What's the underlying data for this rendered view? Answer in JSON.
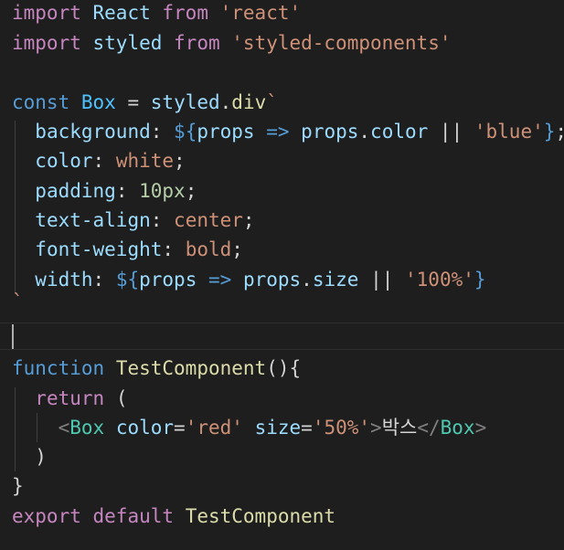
{
  "editor": {
    "lines": {
      "l1": {
        "kw_import": "import",
        "ident": "React",
        "kw_from": "from",
        "str": "'react'"
      },
      "l2": {
        "kw_import": "import",
        "ident": "styled",
        "kw_from": "from",
        "str": "'styled-components'"
      },
      "l4": {
        "kw_const": "const",
        "ident": "Box",
        "eq": "=",
        "styled": "styled",
        "dot": ".",
        "div": "div",
        "tick": "`"
      },
      "l5": {
        "prop": "background",
        "colon": ":",
        "tmpl_open": "${",
        "arg": "props",
        "arrow": "=>",
        "obj": "props",
        "dot": ".",
        "field": "color",
        "or": "||",
        "str": "'blue'",
        "tmpl_close": "}",
        "semi": ";"
      },
      "l6": {
        "prop": "color",
        "colon": ":",
        "value": "white",
        "semi": ";"
      },
      "l7": {
        "prop": "padding",
        "colon": ":",
        "value": "10px",
        "semi": ";"
      },
      "l8": {
        "prop": "text-align",
        "colon": ":",
        "value": "center",
        "semi": ";"
      },
      "l9": {
        "prop": "font-weight",
        "colon": ":",
        "value": "bold",
        "semi": ";"
      },
      "l10": {
        "prop": "width",
        "colon": ":",
        "tmpl_open": "${",
        "arg": "props",
        "arrow": "=>",
        "obj": "props",
        "dot": ".",
        "field": "size",
        "or": "||",
        "str": "'100%'",
        "tmpl_close": "}"
      },
      "l11": {
        "tick": "`"
      },
      "l13": {
        "kw_function": "function",
        "name": "TestComponent",
        "parens": "(){"
      },
      "l14": {
        "kw_return": "return",
        "paren": "("
      },
      "l15": {
        "lt": "<",
        "comp": "Box",
        "attr1": "color",
        "eq1": "=",
        "val1": "'red'",
        "attr2": "size",
        "eq2": "=",
        "val2": "'50%'",
        "gt": ">",
        "text": "박스",
        "close_lt": "</",
        "close_comp": "Box",
        "close_gt": ">"
      },
      "l16": {
        "paren": ")"
      },
      "l17": {
        "brace": "}"
      },
      "l18": {
        "kw_export": "export",
        "kw_default": "default",
        "name": "TestComponent"
      }
    }
  }
}
